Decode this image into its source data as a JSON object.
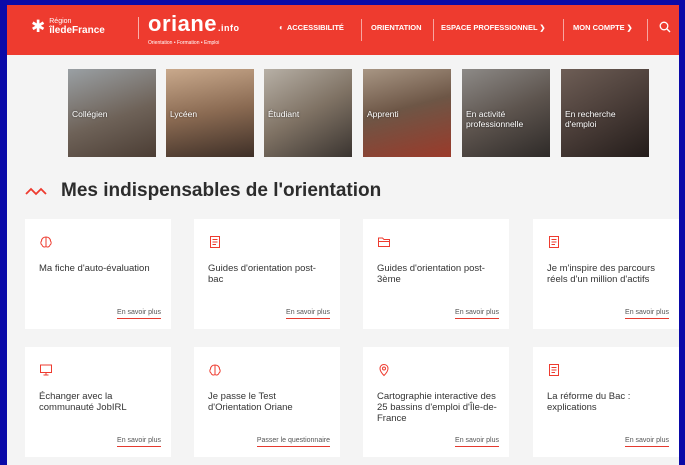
{
  "header": {
    "region_small": "Région",
    "region_big": "îledeFrance",
    "brand_name": "oriane",
    "brand_tld": ".info",
    "brand_tagline": "Orientation • Formation • Emploi",
    "nav": [
      {
        "label": "ACCESSIBILITÉ"
      },
      {
        "label": "ORIENTATION"
      },
      {
        "label": "ESPACE PROFESSIONNEL"
      },
      {
        "label": "MON COMPTE"
      }
    ]
  },
  "profiles": [
    {
      "label": "Collégien"
    },
    {
      "label": "Lycéen"
    },
    {
      "label": "Étudiant"
    },
    {
      "label": "Apprenti"
    },
    {
      "label": "En activité professionnelle"
    },
    {
      "label": "En recherche d'emploi"
    }
  ],
  "section_title": "Mes indispensables de l'orientation",
  "cards": [
    {
      "icon": "brain-icon",
      "title": "Ma fiche d'auto-évaluation",
      "link": "En savoir plus"
    },
    {
      "icon": "document-icon",
      "title": "Guides d'orientation post-bac",
      "link": "En savoir plus"
    },
    {
      "icon": "folder-icon",
      "title": "Guides d'orientation post-3ème",
      "link": "En savoir plus"
    },
    {
      "icon": "document-icon",
      "title": "Je m'inspire des parcours réels d'un million d'actifs",
      "link": "En savoir plus"
    },
    {
      "icon": "monitor-icon",
      "title": "Échanger avec la communauté JobIRL",
      "link": "En savoir plus"
    },
    {
      "icon": "brain-icon",
      "title": "Je passe le Test d'Orientation Oriane",
      "link": "Passer le questionnaire"
    },
    {
      "icon": "map-pin-icon",
      "title": "Cartographie interactive des 25 bassins d'emploi d'Île-de-France",
      "link": "En savoir plus"
    },
    {
      "icon": "document-icon",
      "title": "La réforme du Bac : explications",
      "link": "En savoir plus"
    }
  ],
  "colors": {
    "accent": "#ee3b2f",
    "frame": "#0a0aa8",
    "background": "#f4f4f4"
  }
}
